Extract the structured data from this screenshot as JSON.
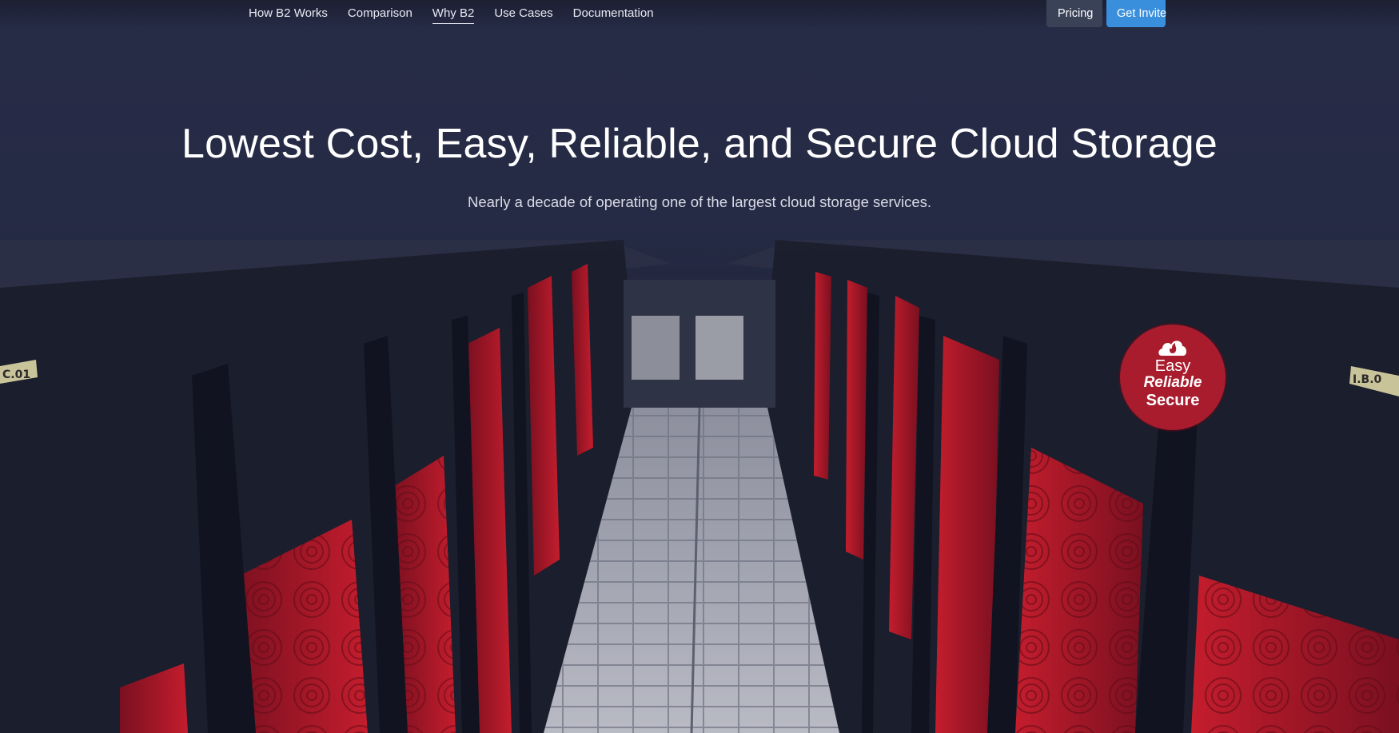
{
  "nav": {
    "links": [
      {
        "label": "How B2 Works",
        "active": false
      },
      {
        "label": "Comparison",
        "active": false
      },
      {
        "label": "Why B2",
        "active": true
      },
      {
        "label": "Use Cases",
        "active": false
      },
      {
        "label": "Documentation",
        "active": false
      }
    ],
    "pricing_label": "Pricing",
    "invite_label": "Get Invite"
  },
  "hero": {
    "title": "Lowest Cost, Easy, Reliable, and Secure Cloud Storage",
    "subtitle": "Nearly a decade of operating one of the largest cloud storage services.",
    "background": "datacenter-aisle-image",
    "rack_labels": [
      "C.01",
      "I.B.0"
    ]
  },
  "badge": {
    "icon": "cloud-flame-icon",
    "easy": "Easy",
    "reliable": "Reliable",
    "secure": "Secure"
  },
  "colors": {
    "background": "#252a44",
    "accent_blue": "#3a8fdd",
    "pricing_button": "#3a4258",
    "badge_red": "#a81c2e",
    "pod_red": "#c11d2c"
  }
}
